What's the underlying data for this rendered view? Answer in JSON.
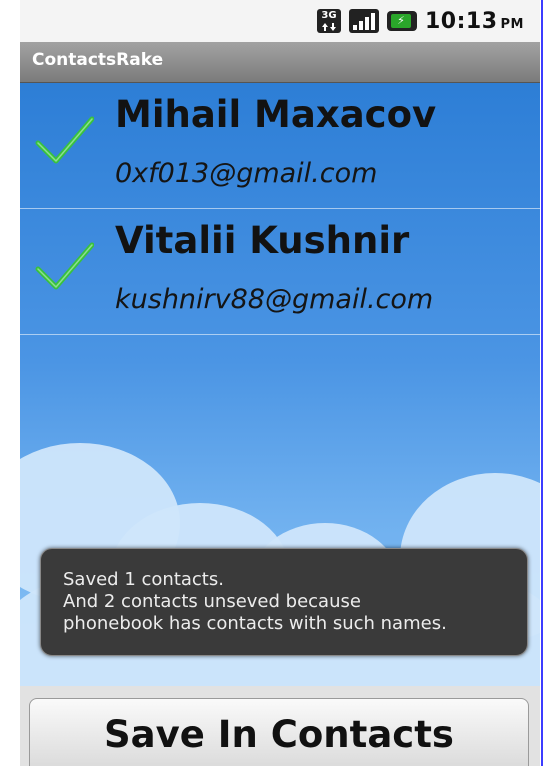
{
  "status_bar": {
    "network_label": "3G",
    "time": "10:13",
    "ampm": "PM"
  },
  "app": {
    "title": "ContactsRake"
  },
  "contacts": [
    {
      "name": "Mihail Maxacov",
      "email": "0xf013@gmail.com",
      "checked": true
    },
    {
      "name": "Vitalii Kushnir",
      "email": "kushnirv88@gmail.com",
      "checked": true
    }
  ],
  "toast": {
    "lines": [
      "Saved 1 contacts.",
      "And 2 contacts unseved because",
      "phonebook has contacts with such names."
    ]
  },
  "footer": {
    "save_button_label": "Save In Contacts"
  },
  "colors": {
    "accent_check": "#39c23e",
    "background_blue": "#2f80d8",
    "toast_bg": "#3a3a3a"
  }
}
